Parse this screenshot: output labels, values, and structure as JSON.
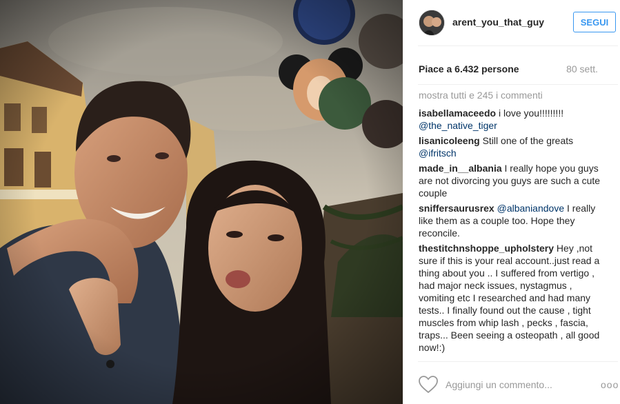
{
  "post": {
    "username": "arent_you_that_guy",
    "follow_label": "SEGUI",
    "likes_text": "Piace a 6.432 persone",
    "age": "80 sett.",
    "show_all": "mostra tutti e 245 i commenti"
  },
  "comments": [
    {
      "user": "isabellamaceedo",
      "text": "i love you!!!!!!!!! ",
      "mention": "@the_native_tiger",
      "after": ""
    },
    {
      "user": "lisanicoleeng",
      "text": "Still one of the greats ",
      "mention": "@ifritsch",
      "after": ""
    },
    {
      "user": "made_in__albania",
      "text": "I really hope you guys are not divorcing you guys are such a cute couple",
      "mention": "",
      "after": ""
    },
    {
      "user": "sniffersaurusrex",
      "text": "",
      "mention": "@albaniandove",
      "after": " I really like them as a couple too. Hope they reconcile."
    },
    {
      "user": "thestitchnshoppe_upholstery",
      "text": "Hey ,not sure if this is your real account..just read a thing about you .. I suffered from vertigo , had major neck issues, nystagmus , vomiting etc I researched and had many tests.. I finally found out the cause , tight muscles from whip lash , pecks , fascia, traps... Been seeing a osteopath , all good now!:)",
      "mention": "",
      "after": ""
    }
  ],
  "footer": {
    "add_comment_placeholder": "Aggiungi un commento...",
    "more_label": "ooo"
  },
  "colors": {
    "accent": "#3897f0",
    "mention": "#003569",
    "muted": "#999999"
  }
}
